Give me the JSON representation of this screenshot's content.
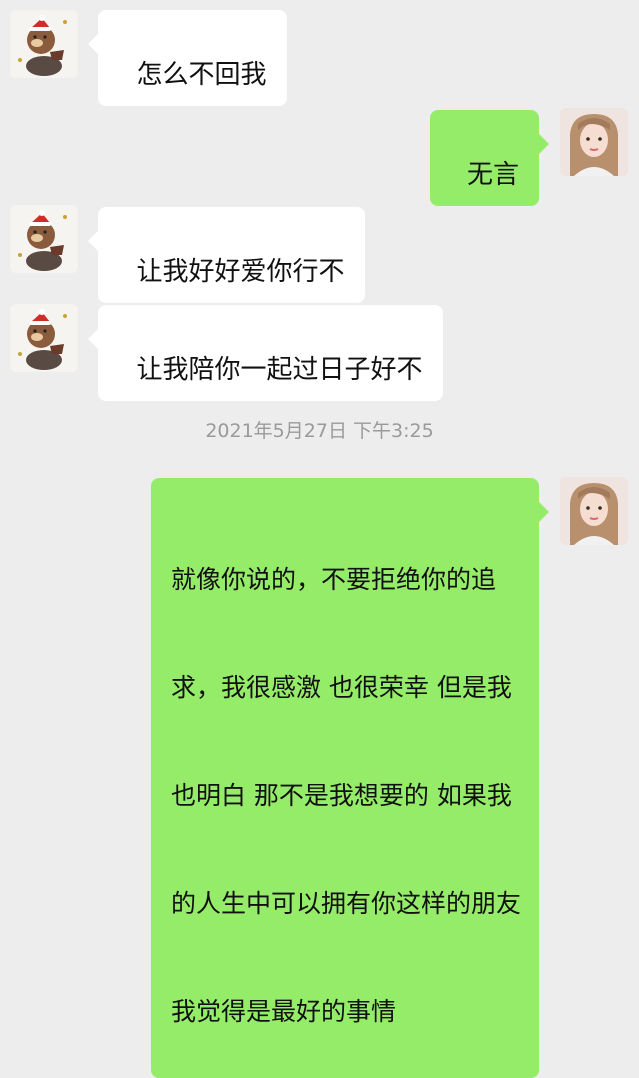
{
  "messages": [
    {
      "side": "in",
      "text": "怎么不回我"
    },
    {
      "side": "out",
      "text": "无言"
    },
    {
      "side": "in",
      "text": "让我好好爱你行不"
    },
    {
      "side": "in",
      "text": "让我陪你一起过日子好不"
    },
    {
      "side": "out",
      "lines": [
        "就像你说的，不要拒绝你的追",
        "求，我很感激 也很荣幸 但是我",
        "也明白 那不是我想要的 如果我",
        "的人生中可以拥有你这样的朋友",
        "我觉得是最好的事情"
      ]
    }
  ],
  "timestamp": "2021年5月27日 下午3:25",
  "colors": {
    "background": "#ededed",
    "incoming_bubble": "#ffffff",
    "outgoing_bubble": "#95ec69",
    "timestamp_text": "#9a9a9a"
  },
  "icons": {
    "incoming_avatar": "bear-santa-hat-avatar-icon",
    "outgoing_avatar": "girl-portrait-avatar-icon"
  }
}
